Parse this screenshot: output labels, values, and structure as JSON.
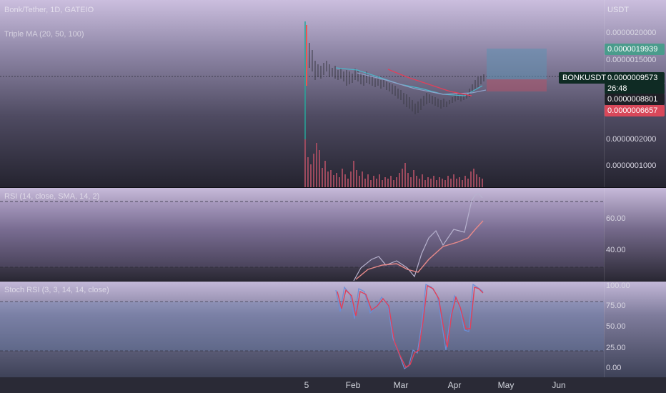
{
  "main": {
    "legend_symbol": "Bonk/Tether, 1D, GATEIO",
    "legend_indicator": "Triple MA (20, 50, 100)",
    "symbol_tag": "BONKUSDT",
    "unit": "USDT",
    "axis_labels": [
      "0.0000020000",
      "0.0000015000",
      "0.0000002000",
      "0.0000001000"
    ],
    "tags": {
      "target": "0.0000019939",
      "last_price": "0.0000009573",
      "countdown": "26:48",
      "ma_value": "0.0000008801",
      "stop": "0.0000006657"
    }
  },
  "rsi": {
    "legend": "RSI (14, close, SMA, 14, 2)",
    "axis_labels": [
      "60.00",
      "40.00"
    ]
  },
  "stoch": {
    "legend": "Stoch RSI (3, 3, 14, 14, close)",
    "axis_labels": [
      "100.00",
      "75.00",
      "50.00",
      "25.00",
      "0.00"
    ]
  },
  "time_axis": [
    "5",
    "Feb",
    "Mar",
    "Apr",
    "May",
    "Jun"
  ],
  "colors": {
    "up": "#26a69a",
    "down": "#ef5350",
    "target_zone": "#5f8fb0",
    "stop_zone": "#b0546a",
    "last_price_bg": "#0f2b24",
    "target_bg": "#4a9c8c",
    "stop_bg": "#d9485a"
  }
}
